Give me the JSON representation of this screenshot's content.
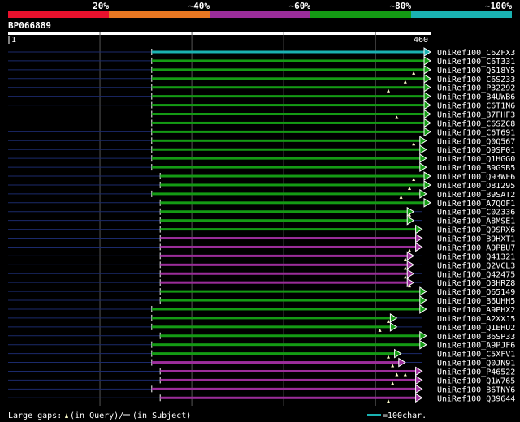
{
  "legend": {
    "percent_labels": [
      "20%",
      "~40%",
      "~60%",
      "~80%",
      "~100%"
    ],
    "band_colors": [
      "#e8112d",
      "#e87722",
      "#9b2d9a",
      "#149b14",
      "#1ab2b2"
    ],
    "footer_gaps_text": "Large gaps:",
    "footer_query_text": "(in Query)/",
    "footer_subject_text": "(in Subject)",
    "scale_text": "=100char.",
    "scale_color": "#1ab2b2"
  },
  "query": {
    "id": "BP066889",
    "start": "1",
    "end": "460",
    "length": 460
  },
  "hits": [
    {
      "name": "UniRef100_C6ZFX3",
      "color": "#1ab2b2",
      "start": 0.34,
      "end": 1.0,
      "gaps": []
    },
    {
      "name": "UniRef100_C6T331",
      "color": "#149b14",
      "start": 0.34,
      "end": 1.0,
      "gaps": []
    },
    {
      "name": "UniRef100_Q518Y5",
      "color": "#149b14",
      "start": 0.34,
      "end": 1.0,
      "gaps": [
        0.96
      ]
    },
    {
      "name": "UniRef100_C6SZ33",
      "color": "#149b14",
      "start": 0.34,
      "end": 1.0,
      "gaps": [
        0.94
      ]
    },
    {
      "name": "UniRef100_P32292",
      "color": "#149b14",
      "start": 0.34,
      "end": 1.0,
      "gaps": [
        0.9
      ]
    },
    {
      "name": "UniRef100_B4UWB6",
      "color": "#149b14",
      "start": 0.34,
      "end": 1.0,
      "gaps": []
    },
    {
      "name": "UniRef100_C6T1N6",
      "color": "#149b14",
      "start": 0.34,
      "end": 1.0,
      "gaps": []
    },
    {
      "name": "UniRef100_B7FHF3",
      "color": "#149b14",
      "start": 0.34,
      "end": 1.0,
      "gaps": [
        0.92
      ]
    },
    {
      "name": "UniRef100_C6SZC8",
      "color": "#149b14",
      "start": 0.34,
      "end": 1.0,
      "gaps": []
    },
    {
      "name": "UniRef100_C6T691",
      "color": "#149b14",
      "start": 0.34,
      "end": 1.0,
      "gaps": []
    },
    {
      "name": "UniRef100_Q0Q567",
      "color": "#149b14",
      "start": 0.34,
      "end": 0.99,
      "gaps": [
        0.96
      ]
    },
    {
      "name": "UniRef100_Q9SP01",
      "color": "#149b14",
      "start": 0.34,
      "end": 0.99,
      "gaps": []
    },
    {
      "name": "UniRef100_Q1HGG0",
      "color": "#149b14",
      "start": 0.34,
      "end": 0.99,
      "gaps": []
    },
    {
      "name": "UniRef100_B9GSB5",
      "color": "#149b14",
      "start": 0.34,
      "end": 0.99,
      "gaps": []
    },
    {
      "name": "UniRef100_Q93WF6",
      "color": "#149b14",
      "start": 0.36,
      "end": 1.0,
      "gaps": [
        0.96
      ]
    },
    {
      "name": "UniRef100_O81295",
      "color": "#149b14",
      "start": 0.36,
      "end": 1.0,
      "gaps": [
        0.95
      ]
    },
    {
      "name": "UniRef100_B9SAT2",
      "color": "#149b14",
      "start": 0.34,
      "end": 0.99,
      "gaps": [
        0.93
      ]
    },
    {
      "name": "UniRef100_A7QOF1",
      "color": "#149b14",
      "start": 0.36,
      "end": 1.0,
      "gaps": []
    },
    {
      "name": "UniRef100_C0Z336",
      "color": "#149b14",
      "start": 0.36,
      "end": 0.96,
      "gaps": [
        0.95
      ]
    },
    {
      "name": "UniRef100_A8MSE1",
      "color": "#149b14",
      "start": 0.36,
      "end": 0.96,
      "gaps": []
    },
    {
      "name": "UniRef100_Q9SRX6",
      "color": "#149b14",
      "start": 0.36,
      "end": 0.98,
      "gaps": []
    },
    {
      "name": "UniRef100_B9HXT1",
      "color": "#9b2d9a",
      "start": 0.36,
      "end": 0.98,
      "gaps": []
    },
    {
      "name": "UniRef100_A9PBU7",
      "color": "#9b2d9a",
      "start": 0.36,
      "end": 0.98,
      "gaps": [
        0.95
      ]
    },
    {
      "name": "UniRef100_Q41321",
      "color": "#9b2d9a",
      "start": 0.36,
      "end": 0.96,
      "gaps": [
        0.94
      ]
    },
    {
      "name": "UniRef100_Q2VCL3",
      "color": "#9b2d9a",
      "start": 0.36,
      "end": 0.96,
      "gaps": [
        0.94
      ]
    },
    {
      "name": "UniRef100_Q42475",
      "color": "#9b2d9a",
      "start": 0.36,
      "end": 0.96,
      "gaps": [
        0.94
      ]
    },
    {
      "name": "UniRef100_Q3HRZ8",
      "color": "#9b2d9a",
      "start": 0.36,
      "end": 0.96,
      "gaps": [
        0.95
      ]
    },
    {
      "name": "UniRef100_O65149",
      "color": "#149b14",
      "start": 0.36,
      "end": 0.99,
      "gaps": []
    },
    {
      "name": "UniRef100_B6UHH5",
      "color": "#149b14",
      "start": 0.36,
      "end": 0.99,
      "gaps": []
    },
    {
      "name": "UniRef100_A9PHX2",
      "color": "#149b14",
      "start": 0.34,
      "end": 0.99,
      "gaps": []
    },
    {
      "name": "UniRef100_A2XXJ5",
      "color": "#149b14",
      "start": 0.34,
      "end": 0.92,
      "gaps": [
        0.9
      ]
    },
    {
      "name": "UniRef100_Q1EHU2",
      "color": "#149b14",
      "start": 0.34,
      "end": 0.92,
      "gaps": [
        0.88
      ]
    },
    {
      "name": "UniRef100_B6SP33",
      "color": "#149b14",
      "start": 0.36,
      "end": 0.99,
      "gaps": []
    },
    {
      "name": "UniRef100_A9PJF6",
      "color": "#149b14",
      "start": 0.34,
      "end": 0.99,
      "gaps": []
    },
    {
      "name": "UniRef100_C5XFV1",
      "color": "#149b14",
      "start": 0.34,
      "end": 0.93,
      "gaps": [
        0.9
      ]
    },
    {
      "name": "UniRef100_Q0JN91",
      "color": "#9b2d9a",
      "start": 0.34,
      "end": 0.94,
      "gaps": [
        0.91
      ]
    },
    {
      "name": "UniRef100_P46522",
      "color": "#9b2d9a",
      "start": 0.36,
      "end": 0.98,
      "gaps": [
        0.92,
        0.94
      ]
    },
    {
      "name": "UniRef100_Q1W765",
      "color": "#9b2d9a",
      "start": 0.36,
      "end": 0.98,
      "gaps": [
        0.91
      ]
    },
    {
      "name": "UniRef100_B6TNY6",
      "color": "#9b2d9a",
      "start": 0.34,
      "end": 0.98,
      "gaps": []
    },
    {
      "name": "UniRef100_Q39644",
      "color": "#9b2d9a",
      "start": 0.36,
      "end": 0.98,
      "gaps": [
        0.9
      ]
    }
  ]
}
